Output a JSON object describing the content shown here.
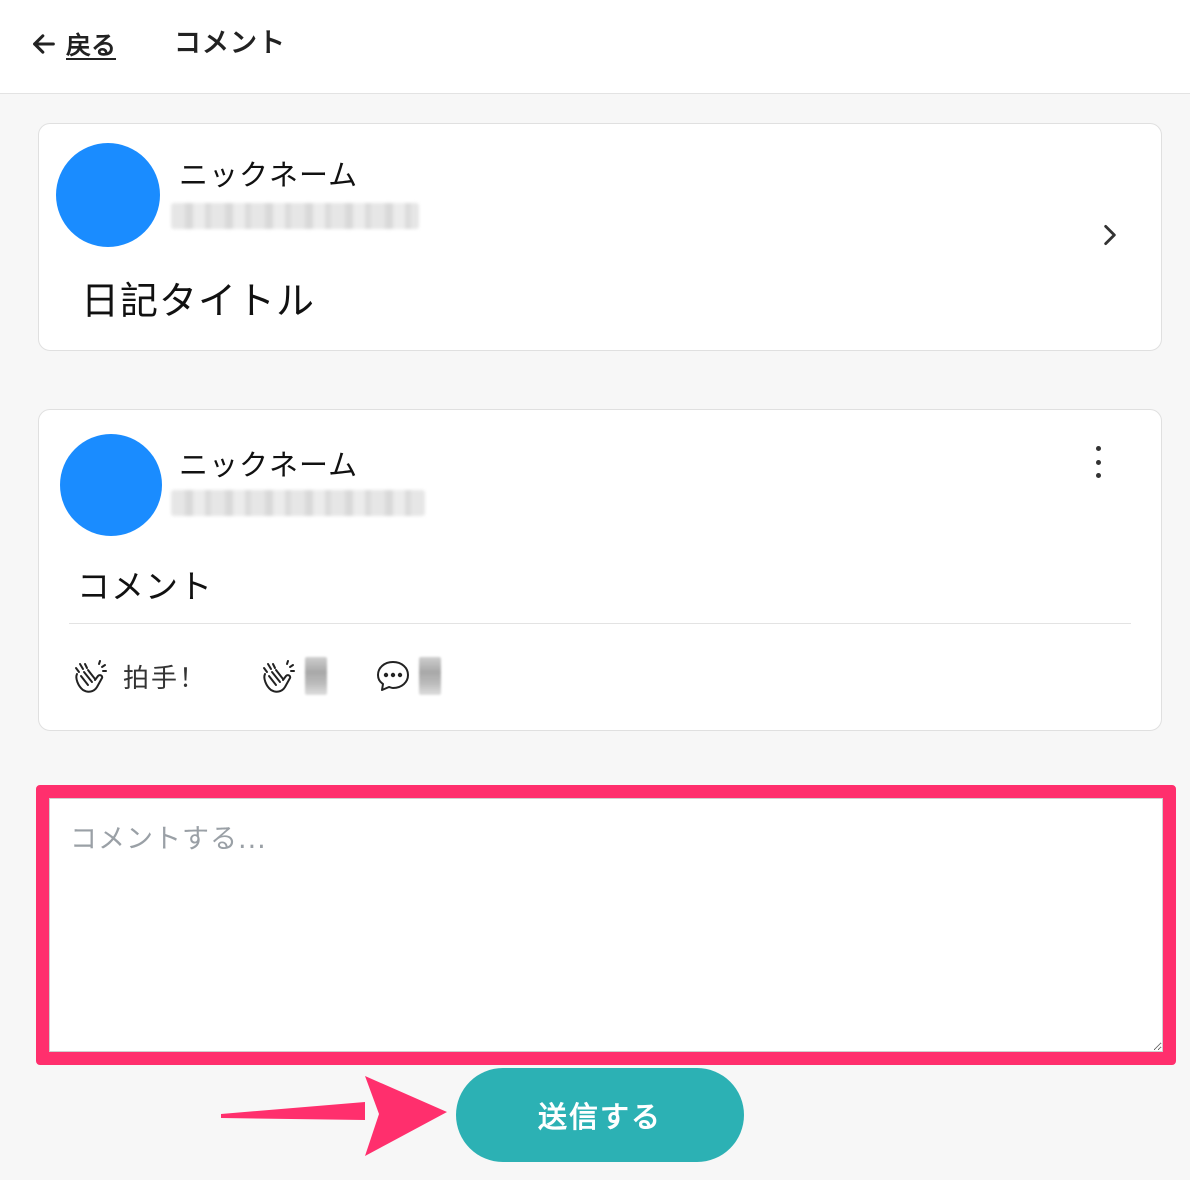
{
  "header": {
    "back_label": "戻る",
    "title": "コメント"
  },
  "diary": {
    "nickname": "ニックネーム",
    "title": "日記タイトル"
  },
  "comment": {
    "nickname": "ニックネーム",
    "body": "コメント",
    "clap_label": "拍手！"
  },
  "form": {
    "placeholder": "コメントする...",
    "submit_label": "送信する"
  },
  "colors": {
    "avatar": "#1a8cff",
    "highlight": "#ff2f6d",
    "submit": "#2cb1b4"
  }
}
